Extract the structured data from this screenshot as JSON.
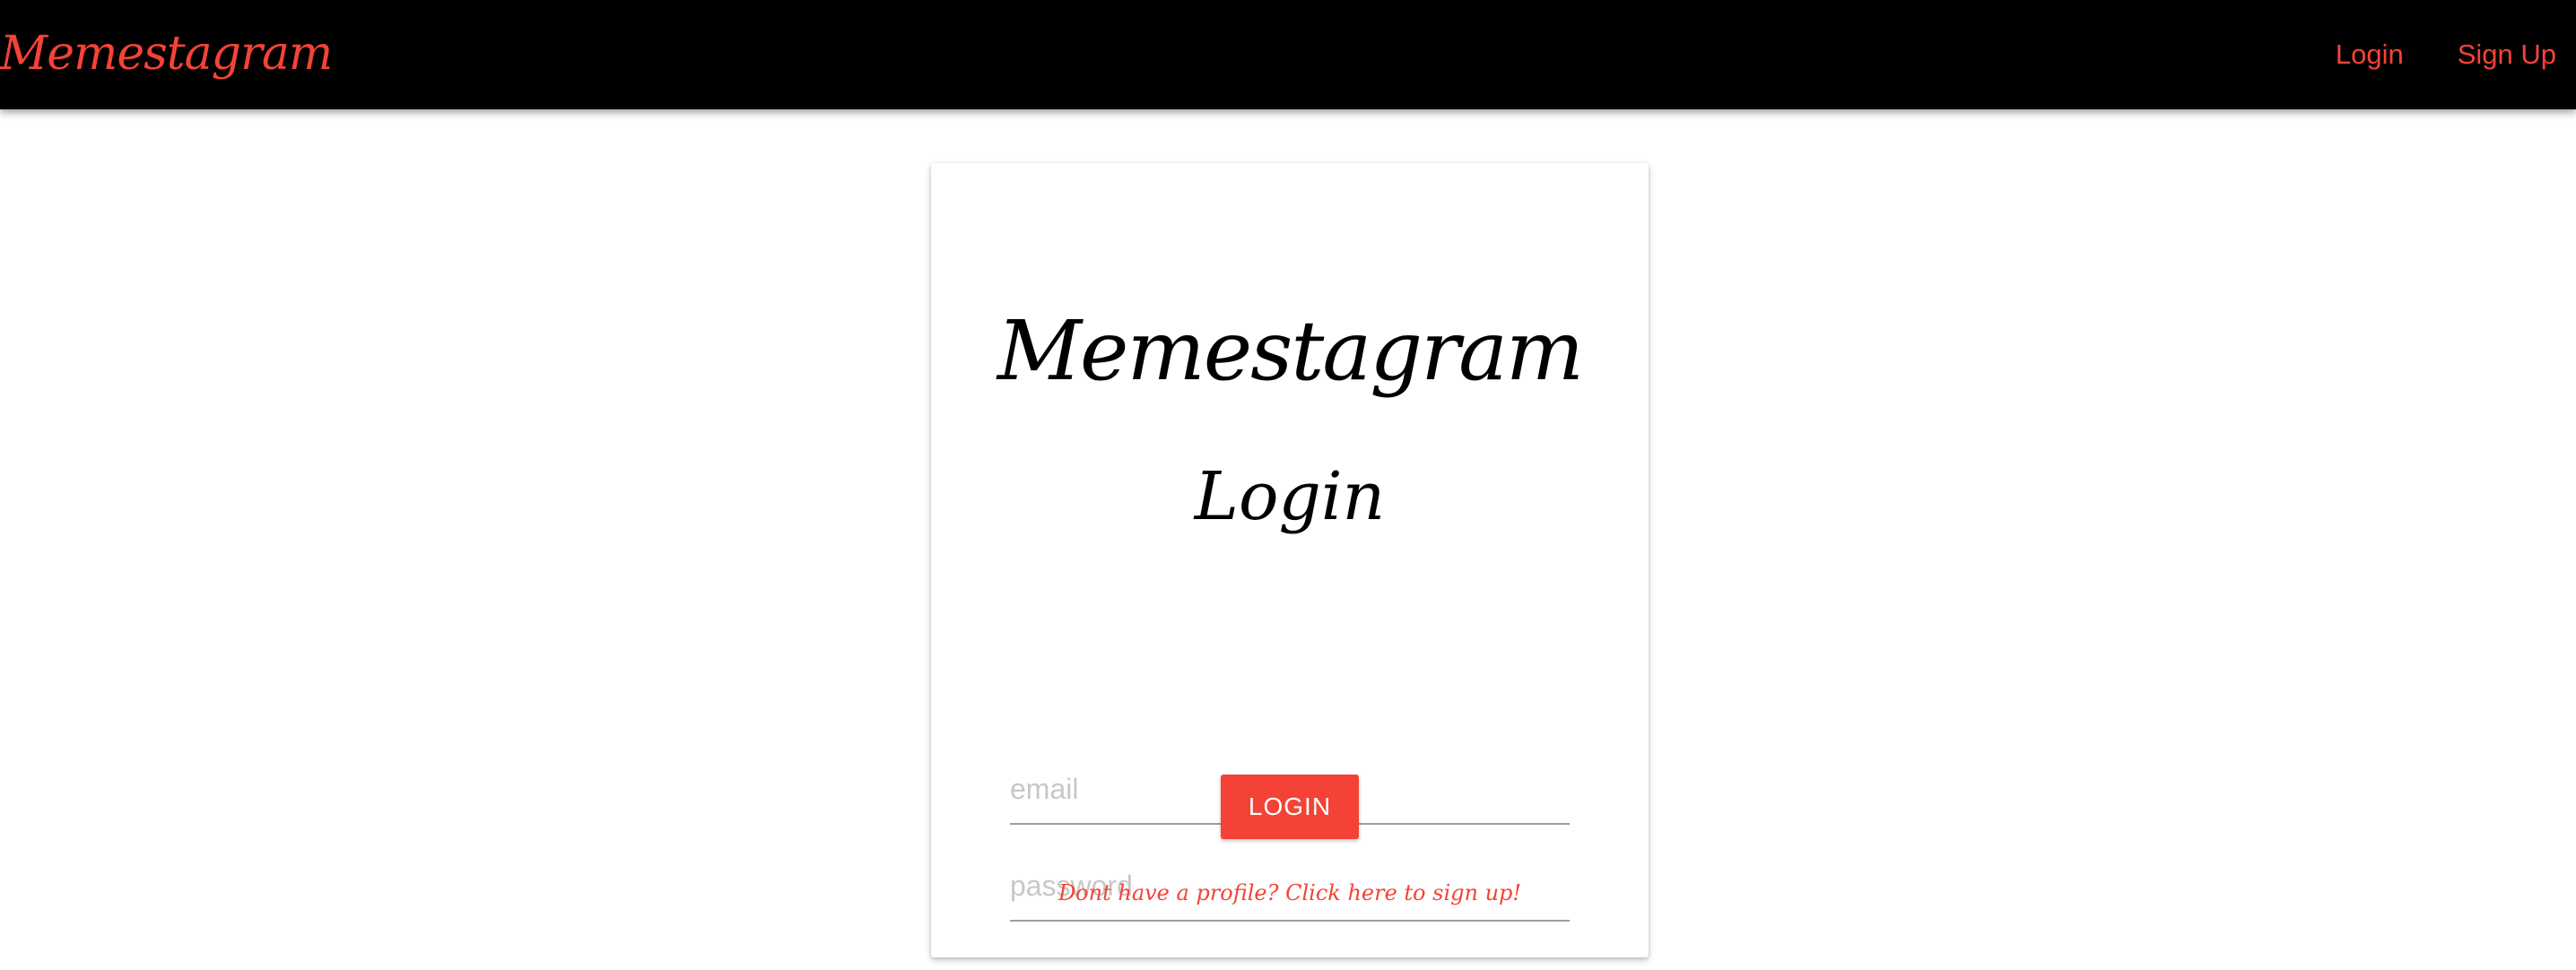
{
  "navbar": {
    "brand": "Memestagram",
    "links": [
      {
        "label": "Login"
      },
      {
        "label": "Sign Up"
      }
    ]
  },
  "card": {
    "title": "Memestagram",
    "subtitle": "Login",
    "email_placeholder": "email",
    "password_placeholder": "password",
    "login_button": "LOGIN",
    "signup_prompt": "Dont have a profile? Click here to sign up!"
  },
  "colors": {
    "accent": "#f44336",
    "navbar_bg": "#000000",
    "underline": "#9e9e9e",
    "placeholder": "#c8c8c8"
  }
}
